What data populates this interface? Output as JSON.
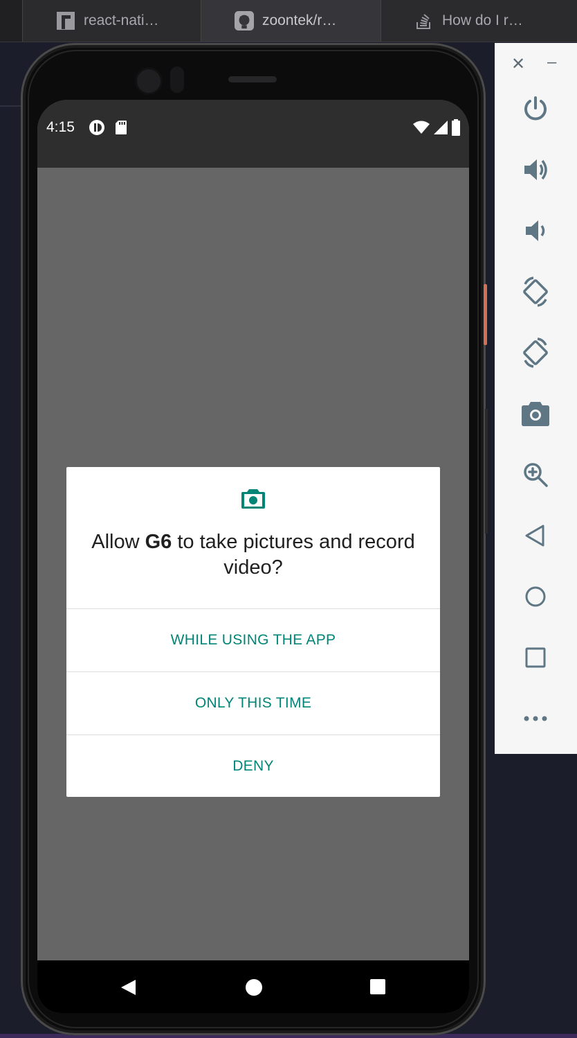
{
  "browser": {
    "tabs": [
      {
        "label": "react-nati…",
        "icon": "npm-icon"
      },
      {
        "label": "zoontek/r…",
        "icon": "github-icon"
      },
      {
        "label": "How do I r…",
        "icon": "stackoverflow-icon"
      }
    ]
  },
  "status_bar": {
    "time": "4:15",
    "icons_left": [
      "notification-app-icon",
      "sd-card-icon"
    ],
    "icons_right": [
      "wifi-icon",
      "cell-signal-icon",
      "battery-icon"
    ]
  },
  "dialog": {
    "icon": "camera-icon",
    "title_prefix": "Allow ",
    "app_name": "G6",
    "title_suffix": " to take pictures and record video?",
    "buttons": {
      "while_using": "WHILE USING THE APP",
      "only_this_time": "ONLY THIS TIME",
      "deny": "DENY"
    },
    "accent_color": "#008577"
  },
  "nav_bar": {
    "buttons": [
      "back-icon",
      "home-icon",
      "recents-icon"
    ]
  },
  "emulator_toolbar": {
    "close": "✕",
    "minimize": "–",
    "tools": [
      "power-icon",
      "volume-up-icon",
      "volume-down-icon",
      "rotate-left-icon",
      "rotate-right-icon",
      "screenshot-icon",
      "zoom-icon",
      "back-icon",
      "home-icon",
      "overview-icon",
      "more-icon"
    ]
  }
}
